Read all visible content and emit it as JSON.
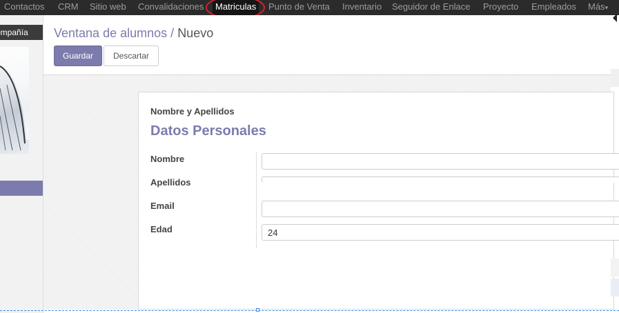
{
  "nav": {
    "items": [
      {
        "label": "Contactos"
      },
      {
        "label": "CRM"
      },
      {
        "label": "Sitio web"
      },
      {
        "label": "Convalidaciones"
      },
      {
        "label": "Matriculas"
      },
      {
        "label": "Punto de Venta"
      },
      {
        "label": "Inventario"
      },
      {
        "label": "Seguidor de Enlace"
      },
      {
        "label": "Proyecto"
      },
      {
        "label": "Empleados"
      },
      {
        "label": "Más"
      }
    ],
    "active": "Matriculas"
  },
  "sidebar": {
    "company_label": "ompañía"
  },
  "header": {
    "breadcrumb_parent": "Ventana de alumnos",
    "breadcrumb_separator": "/",
    "breadcrumb_current": "Nuevo",
    "save_label": "Guardar",
    "discard_label": "Descartar"
  },
  "form": {
    "subtitle": "Nombre y Apellidos",
    "title": "Datos Personales",
    "fields": [
      {
        "label": "Nombre",
        "value": ""
      },
      {
        "label": "Apellidos",
        "value": ""
      },
      {
        "label": "Email",
        "value": ""
      },
      {
        "label": "Edad",
        "value": "24"
      }
    ]
  },
  "colors": {
    "accent": "#7c7bad",
    "topbar": "#2b2b2b",
    "highlight_circle": "#e0202a"
  }
}
